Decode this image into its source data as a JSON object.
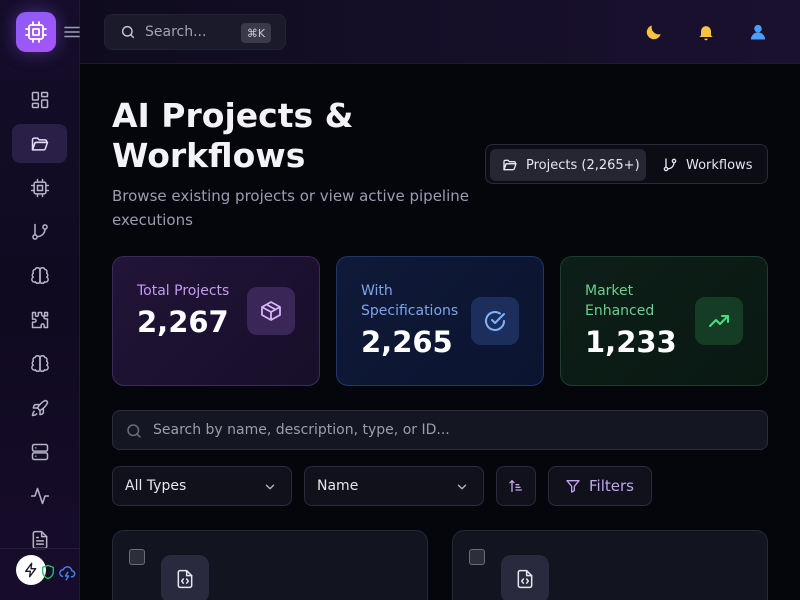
{
  "sidebar": {
    "logo_icon": "cpu-icon",
    "toggle_icon": "menu-icon",
    "items": [
      {
        "icon": "dashboard-icon",
        "active": false
      },
      {
        "icon": "folder-open-icon",
        "active": true
      },
      {
        "icon": "cpu-icon",
        "active": false
      },
      {
        "icon": "git-branch-icon",
        "active": false
      },
      {
        "icon": "brain-icon",
        "active": false
      },
      {
        "icon": "puzzle-icon",
        "active": false
      },
      {
        "icon": "brain-icon",
        "active": false
      },
      {
        "icon": "rocket-icon",
        "active": false
      },
      {
        "icon": "server-icon",
        "active": false
      },
      {
        "icon": "activity-icon",
        "active": false
      },
      {
        "icon": "file-text-icon",
        "active": false
      }
    ],
    "footer": {
      "bolt_icon": "bolt-icon",
      "shield_icon": "shield-icon",
      "cloud_icon": "cloud-lightning-icon"
    }
  },
  "topbar": {
    "search_placeholder": "Search...",
    "shortcut": "⌘K",
    "icons": [
      "moon-icon",
      "bell-icon",
      "user-icon"
    ]
  },
  "page": {
    "title": "AI Projects & Workflows",
    "subtitle": "Browse existing projects or view active pipeline executions"
  },
  "view_toggle": {
    "projects_label": "Projects (2,265+)",
    "workflows_label": "Workflows",
    "active": "projects"
  },
  "stats": [
    {
      "label": "Total Projects",
      "value": "2,267",
      "icon": "box-icon",
      "accent": "#a855f7"
    },
    {
      "label": "With Specifications",
      "value": "2,265",
      "icon": "check-circle-icon",
      "accent": "#3b82f6"
    },
    {
      "label": "Market Enhanced",
      "value": "1,233",
      "icon": "trending-up-icon",
      "accent": "#22c55e"
    }
  ],
  "search": {
    "placeholder": "Search by name, description, type, or ID..."
  },
  "filters": {
    "type_selected": "All Types",
    "sort_selected": "Name",
    "filters_label": "Filters"
  },
  "colors": {
    "accent": "#8b5cf6",
    "background": "#05060c",
    "sidebar": "#150d2a"
  }
}
